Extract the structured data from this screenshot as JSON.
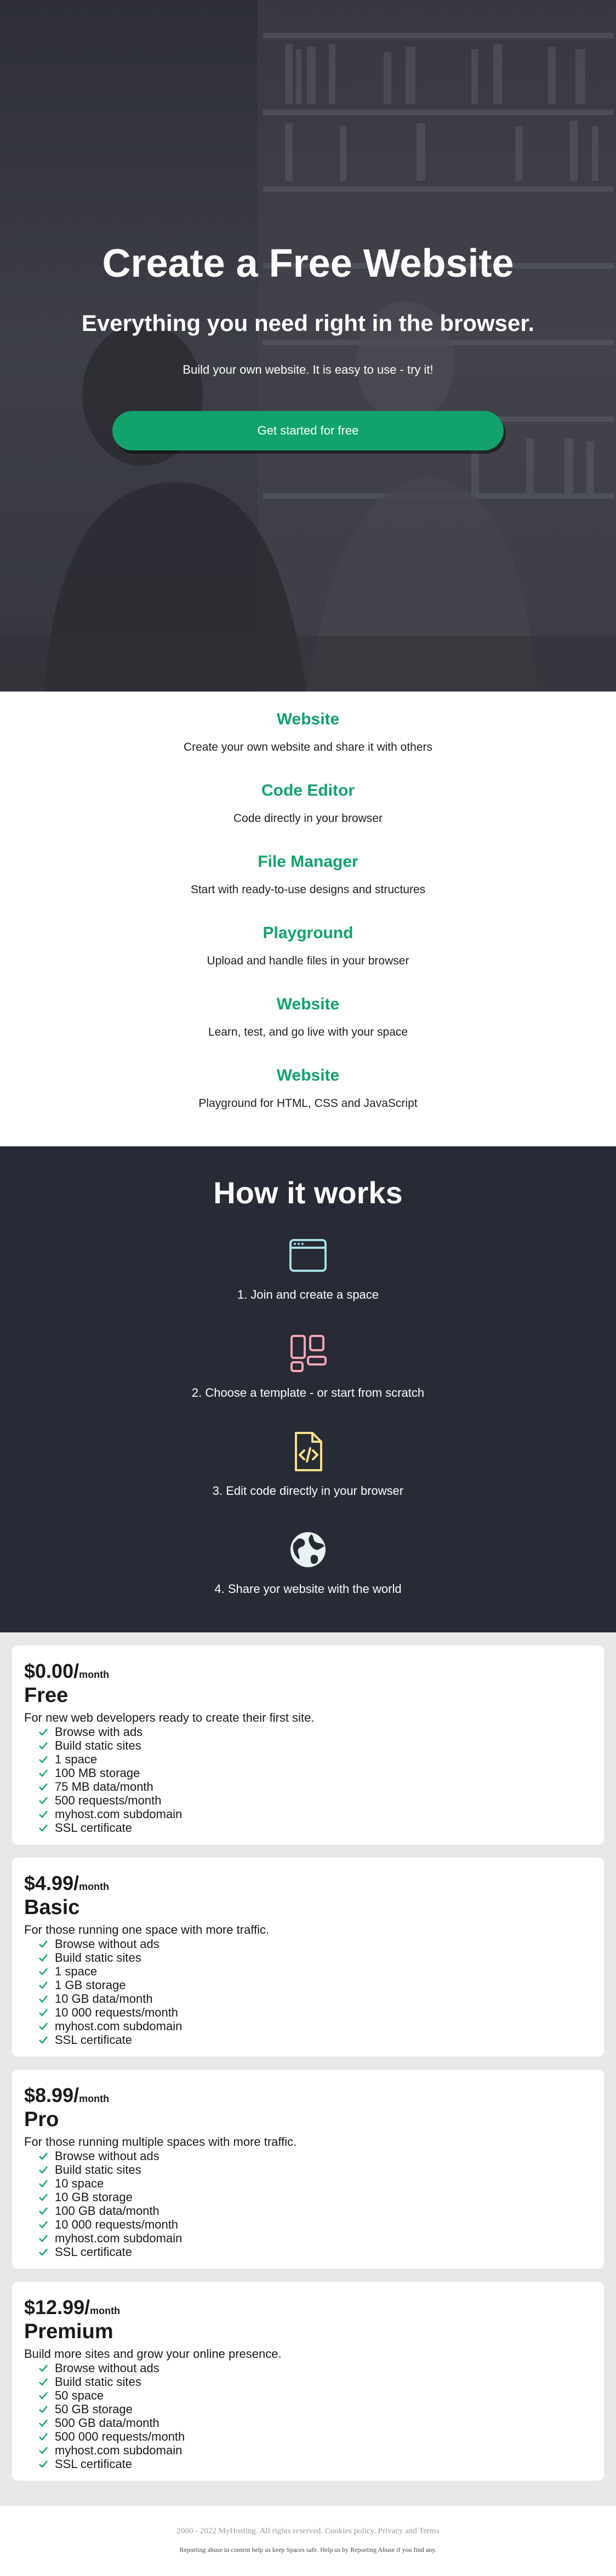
{
  "hero": {
    "title": "Create a Free Website",
    "subtitle": "Everything you need right in the browser.",
    "description": "Build your own website. It is easy to use - try it!",
    "cta_label": "Get started for free"
  },
  "features": [
    {
      "title": "Website",
      "text": "Create your own website and share it with others"
    },
    {
      "title": "Code Editor",
      "text": "Code directly in your browser"
    },
    {
      "title": "File Manager",
      "text": "Start with ready-to-use designs and structures"
    },
    {
      "title": "Playground",
      "text": "Upload and handle files in your browser"
    },
    {
      "title": "Website",
      "text": "Learn, test, and go live with your space"
    },
    {
      "title": "Website",
      "text": "Playground for HTML, CSS and JavaScript"
    }
  ],
  "how": {
    "title": "How it works",
    "steps": [
      {
        "icon": "browser-window-icon",
        "text": "1. Join and create a space"
      },
      {
        "icon": "template-layout-icon",
        "text": "2. Choose a template - or start from scratch"
      },
      {
        "icon": "code-file-icon",
        "text": "3. Edit code directly in your browser"
      },
      {
        "icon": "globe-icon",
        "text": "4. Share yor website with the world"
      }
    ]
  },
  "colors": {
    "accent": "#11a36b",
    "dark_section": "#282a35",
    "icon_cyan": "#a6dfe5",
    "icon_pink": "#f5a6b5",
    "icon_yellow": "#f6e08c",
    "icon_white": "#e8f2f2"
  },
  "pricing": [
    {
      "price": "$0.00/",
      "period": "month",
      "name": "Free",
      "description": "For new web developers ready to create their first site.",
      "features": [
        "Browse with ads",
        "Build static sites",
        "1 space",
        "100 MB storage",
        "75 MB data/month",
        "500 requests/month",
        "myhost.com subdomain",
        "SSL certificate"
      ]
    },
    {
      "price": "$4.99/",
      "period": "month",
      "name": "Basic",
      "description": "For those running one space with more traffic.",
      "features": [
        "Browse without ads",
        "Build static sites",
        "1 space",
        "1 GB storage",
        "10 GB data/month",
        "10 000 requests/month",
        "myhost.com subdomain",
        "SSL certificate"
      ]
    },
    {
      "price": "$8.99/",
      "period": "month",
      "name": "Pro",
      "description": "For those running multiple spaces with more traffic.",
      "features": [
        "Browse without ads",
        "Build static sites",
        "10 space",
        "10 GB storage",
        "100 GB data/month",
        "10 000 requests/month",
        "myhost.com subdomain",
        "SSL certificate"
      ]
    },
    {
      "price": "$12.99/",
      "period": "month",
      "name": "Premium",
      "description": "Build more sites and grow your online presence.",
      "features": [
        "Browse without ads",
        "Build static sites",
        "50 space",
        "50 GB storage",
        "500 GB data/month",
        "500 000 requests/month",
        "myhost.com subdomain",
        "SSL certificate"
      ]
    }
  ],
  "footer": {
    "copyright": "2000 - 2022 MyHosting. All rights reserved.",
    "cookies_label": "Cookies policy.",
    "privacy_label": "Privacy and Terms",
    "note": "Reporting abuse in content help us keep Spaces safe. Help us by Reporting Abuse if you find any."
  }
}
